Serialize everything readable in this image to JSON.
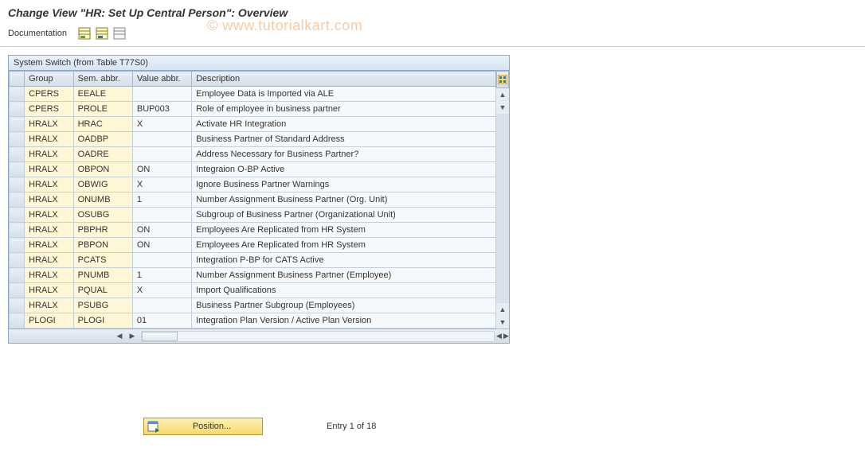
{
  "title": "Change View \"HR: Set Up Central Person\": Overview",
  "toolbar": {
    "documentation": "Documentation"
  },
  "watermark": "© www.tutorialkart.com",
  "panel": {
    "title": "System Switch (from Table T77S0)",
    "columns": {
      "group": "Group",
      "abbr": "Sem. abbr.",
      "val": "Value abbr.",
      "desc": "Description"
    },
    "rows": [
      {
        "group": "CPERS",
        "abbr": "EEALE",
        "val": "",
        "desc": "Employee Data is Imported via ALE"
      },
      {
        "group": "CPERS",
        "abbr": "PROLE",
        "val": "BUP003",
        "desc": "Role of employee in business partner"
      },
      {
        "group": "HRALX",
        "abbr": "HRAC",
        "val": "X",
        "desc": "Activate HR Integration"
      },
      {
        "group": "HRALX",
        "abbr": "OADBP",
        "val": "",
        "desc": "Business Partner of Standard Address"
      },
      {
        "group": "HRALX",
        "abbr": "OADRE",
        "val": "",
        "desc": "Address Necessary for Business Partner?"
      },
      {
        "group": "HRALX",
        "abbr": "OBPON",
        "val": "ON",
        "desc": "Integraion O-BP Active"
      },
      {
        "group": "HRALX",
        "abbr": "OBWIG",
        "val": "X",
        "desc": "Ignore Business Partner Warnings"
      },
      {
        "group": "HRALX",
        "abbr": "ONUMB",
        "val": "1",
        "desc": "Number Assignment Business Partner (Org. Unit)"
      },
      {
        "group": "HRALX",
        "abbr": "OSUBG",
        "val": "",
        "desc": "Subgroup of Business Partner (Organizational Unit)"
      },
      {
        "group": "HRALX",
        "abbr": "PBPHR",
        "val": "ON",
        "desc": "Employees Are Replicated from HR System"
      },
      {
        "group": "HRALX",
        "abbr": "PBPON",
        "val": "ON",
        "desc": "Employees Are Replicated from HR System"
      },
      {
        "group": "HRALX",
        "abbr": "PCATS",
        "val": "",
        "desc": "Integration P-BP for CATS Active"
      },
      {
        "group": "HRALX",
        "abbr": "PNUMB",
        "val": "1",
        "desc": "Number Assignment Business Partner (Employee)"
      },
      {
        "group": "HRALX",
        "abbr": "PQUAL",
        "val": "X",
        "desc": "Import Qualifications"
      },
      {
        "group": "HRALX",
        "abbr": "PSUBG",
        "val": "",
        "desc": "Business Partner Subgroup (Employees)"
      },
      {
        "group": "PLOGI",
        "abbr": "PLOGI",
        "val": "01",
        "desc": "Integration Plan Version / Active Plan Version"
      }
    ]
  },
  "footer": {
    "position_label": "Position...",
    "entry_text": "Entry 1 of 18"
  }
}
